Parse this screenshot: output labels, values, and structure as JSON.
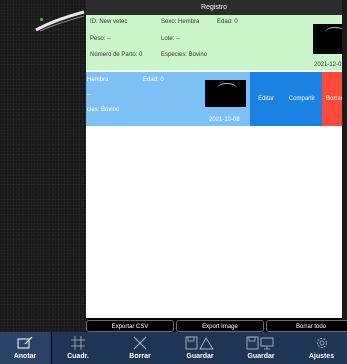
{
  "header": {
    "title": "Registro"
  },
  "record1": {
    "id": "ID: New vetec",
    "sex": "Sexo: Hembra",
    "age": "Edad: 0",
    "weight": "Peso: --",
    "lot": "Lote: --",
    "births": "Número de Parto: 0",
    "species": "Especies: Bovino",
    "date": "2021-12-0"
  },
  "record2": {
    "sex": "Hembra",
    "age": "Edad: 0",
    "weight": "--",
    "species": "cies: Bovino",
    "date": "2021-12-08",
    "actions": {
      "edit": "Editar",
      "share": "Compartir",
      "delete": "Borrar"
    }
  },
  "exports": {
    "csv": "Exportar CSV",
    "image": "Export Image",
    "delete_all": "Borrar todo"
  },
  "toolbar": {
    "annotate": "Anotar",
    "grid": "Cuadr.",
    "erase": "Borrar",
    "save": "Guardar",
    "save2": "Guardar",
    "settings": "Ajustes"
  },
  "colors": {
    "accent": "#1a82e2",
    "delete": "#ff4a3a",
    "card_green": "#c9f5c9",
    "card_blue": "#7cc0f6",
    "toolbar": "#1f3554"
  }
}
